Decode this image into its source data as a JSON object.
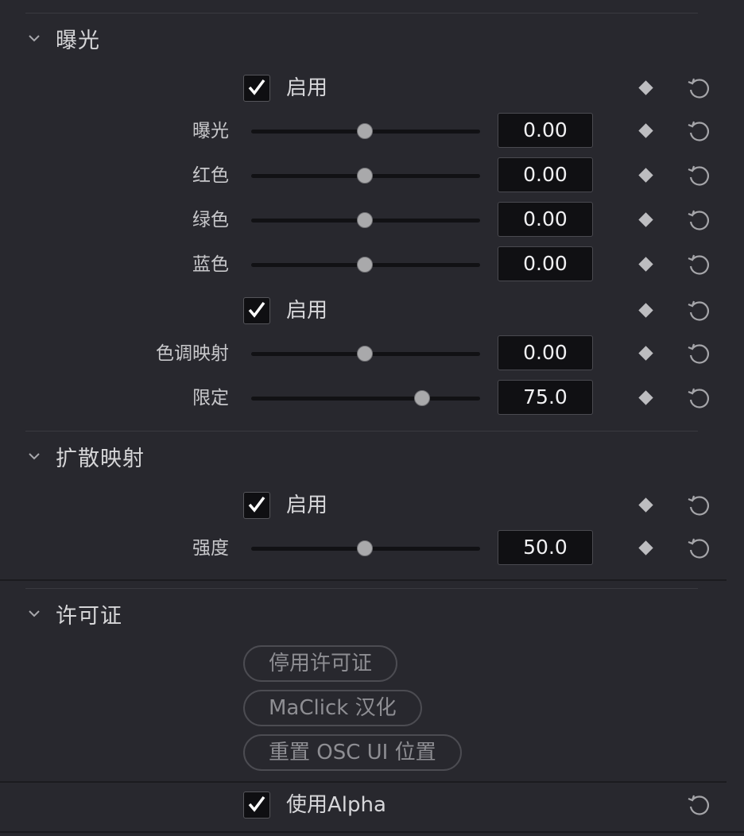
{
  "sections": {
    "exposure": {
      "title": "曝光"
    },
    "diffuse": {
      "title": "扩散映射"
    },
    "license": {
      "title": "许可证"
    }
  },
  "exposure": {
    "enable1": {
      "label": "启用",
      "checked": true
    },
    "sliders": [
      {
        "label": "曝光",
        "value": "0.00",
        "level": 0.5
      },
      {
        "label": "红色",
        "value": "0.00",
        "level": 0.5
      },
      {
        "label": "绿色",
        "value": "0.00",
        "level": 0.5
      },
      {
        "label": "蓝色",
        "value": "0.00",
        "level": 0.5
      }
    ],
    "enable2": {
      "label": "启用",
      "checked": true
    },
    "tonemap": {
      "label": "色调映射",
      "value": "0.00",
      "level": 0.5
    },
    "limit": {
      "label": "限定",
      "value": "75.0",
      "level": 0.75
    }
  },
  "diffuse": {
    "enable": {
      "label": "启用",
      "checked": true
    },
    "strength": {
      "label": "强度",
      "value": "50.0",
      "level": 0.5
    }
  },
  "license": {
    "buttons": [
      "停用许可证",
      "MaClick 汉化",
      "重置 OSC UI 位置"
    ]
  },
  "use_alpha": {
    "label": "使用Alpha",
    "checked": true
  },
  "icons": {
    "keyframe": "diamond-icon",
    "reset": "reset-icon",
    "collapse": "chevron-down-icon",
    "check": "checkmark-icon"
  },
  "colors": {
    "background": "#28282e",
    "field": "#101013",
    "accent_text": "#f1f1f3"
  }
}
